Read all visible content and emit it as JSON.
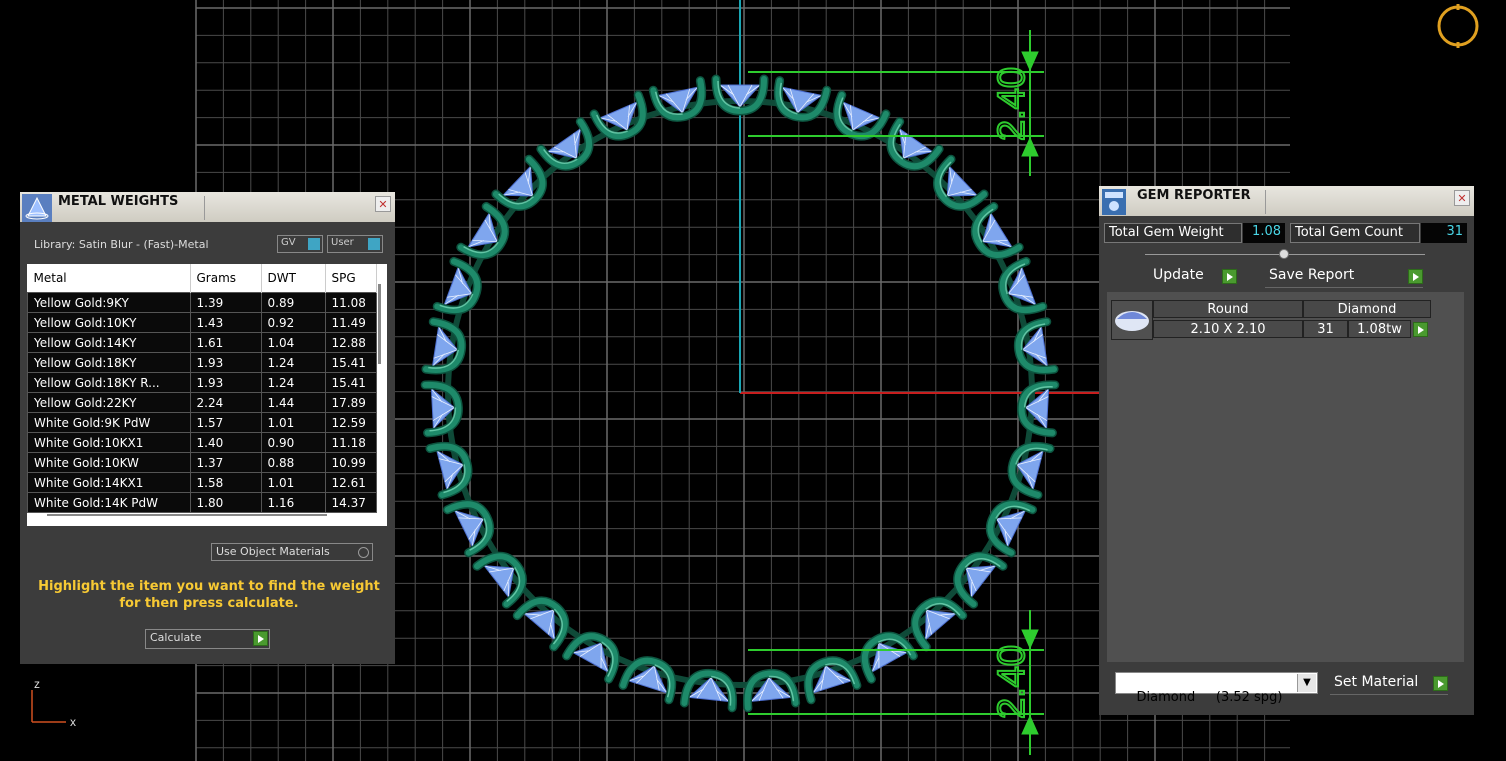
{
  "metal_weights": {
    "title": "METAL WEIGHTS",
    "library": "Library: Satin Blur - (Fast)-Metal",
    "gv_label": "GV",
    "user_label": "User",
    "columns": [
      "Metal",
      "Grams",
      "DWT",
      "SPG"
    ],
    "rows": [
      [
        "Yellow Gold:9KY",
        "1.39",
        "0.89",
        "11.08"
      ],
      [
        "Yellow Gold:10KY",
        "1.43",
        "0.92",
        "11.49"
      ],
      [
        "Yellow Gold:14KY",
        "1.61",
        "1.04",
        "12.88"
      ],
      [
        "Yellow Gold:18KY",
        "1.93",
        "1.24",
        "15.41"
      ],
      [
        "Yellow Gold:18KY R...",
        "1.93",
        "1.24",
        "15.41"
      ],
      [
        "Yellow Gold:22KY",
        "2.24",
        "1.44",
        "17.89"
      ],
      [
        "White Gold:9K PdW",
        "1.57",
        "1.01",
        "12.59"
      ],
      [
        "White Gold:10KX1",
        "1.40",
        "0.90",
        "11.18"
      ],
      [
        "White Gold:10KW",
        "1.37",
        "0.88",
        "10.99"
      ],
      [
        "White Gold:14KX1",
        "1.58",
        "1.01",
        "12.61"
      ],
      [
        "White Gold:14K PdW",
        "1.80",
        "1.16",
        "14.37"
      ]
    ],
    "use_object_materials": "Use Object Materials",
    "hint": "Highlight the item you want to find the weight for then press calculate.",
    "calculate": "Calculate"
  },
  "gem_reporter": {
    "title": "GEM REPORTER",
    "total_weight_label": "Total Gem Weight",
    "total_weight_value": "1.08",
    "total_count_label": "Total Gem Count",
    "total_count_value": "31",
    "update": "Update",
    "save_report": "Save Report",
    "gem_headers": [
      "Round",
      "Diamond"
    ],
    "gem_size": "2.10 X 2.10",
    "gem_count": "31",
    "gem_weight": "1.08tw",
    "material_select": "Diamond     (3.52 spg)",
    "set_material": "Set Material"
  },
  "viewport": {
    "dimension_top": "2.40",
    "dimension_bottom": "2.40",
    "axis_z": "z",
    "axis_x": "x",
    "gem_count_visual": 31,
    "colors": {
      "ring": "#1e8a6a",
      "gem": "#7fa6ee",
      "dimension": "#2ecc2e",
      "grid": "#5a5a5a",
      "axis_red": "#c81e1e",
      "axis_cyan": "#1aa6b4"
    }
  }
}
